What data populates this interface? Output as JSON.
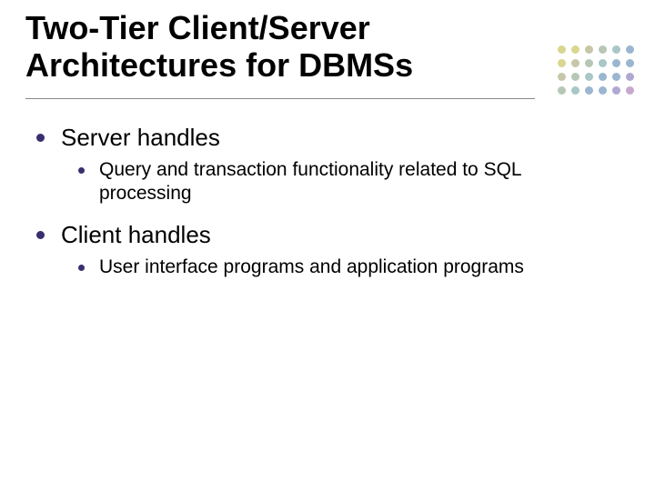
{
  "title": "Two-Tier Client/Server Architectures for DBMSs",
  "items": [
    {
      "label": "Server handles",
      "sub": [
        "Query and transaction functionality related to SQL processing"
      ]
    },
    {
      "label": "Client handles",
      "sub": [
        "User interface programs and application programs"
      ]
    }
  ],
  "decor": {
    "dotColors": [
      "#d9d68f",
      "#d9d68f",
      "#c6c7a8",
      "#b6c7b6",
      "#a8c7c6",
      "#9ab6d1",
      "#d9d68f",
      "#c6c7a8",
      "#b6c7b6",
      "#a8c7c6",
      "#9ab6d1",
      "#9ab6d1",
      "#c6c7a8",
      "#b6c7b6",
      "#a8c7c6",
      "#9ab6d1",
      "#9ab6d1",
      "#b0a8d1",
      "#b6c7b6",
      "#a8c7c6",
      "#9ab6d1",
      "#9ab6d1",
      "#b0a8d1",
      "#c7a8cf"
    ]
  }
}
